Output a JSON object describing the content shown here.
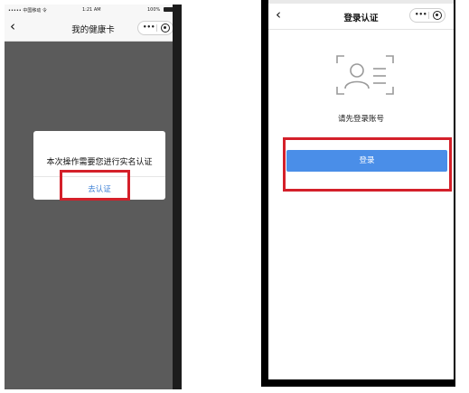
{
  "left_screen": {
    "status_bar": {
      "carrier": "••••• 中国移动 令",
      "time": "1:21 AM",
      "battery": "100%"
    },
    "nav": {
      "back_icon": "chevron-left-icon",
      "title": "我的健康卡",
      "capsule_more_icon": "more-dots-icon",
      "capsule_close_icon": "target-close-icon"
    },
    "dialog": {
      "message": "本次操作需要您进行实名认证",
      "action_label": "去认证"
    },
    "highlight_color": "#d4202a"
  },
  "right_screen": {
    "nav": {
      "back_icon": "chevron-left-icon",
      "title": "登录认证",
      "capsule_more_icon": "more-dots-icon",
      "capsule_close_icon": "target-close-icon"
    },
    "illustration_icon": "id-card-scan-icon",
    "prompt": "请先登录账号",
    "login_button_label": "登录",
    "button_color": "#4a8ee8",
    "highlight_color": "#d4202a"
  }
}
